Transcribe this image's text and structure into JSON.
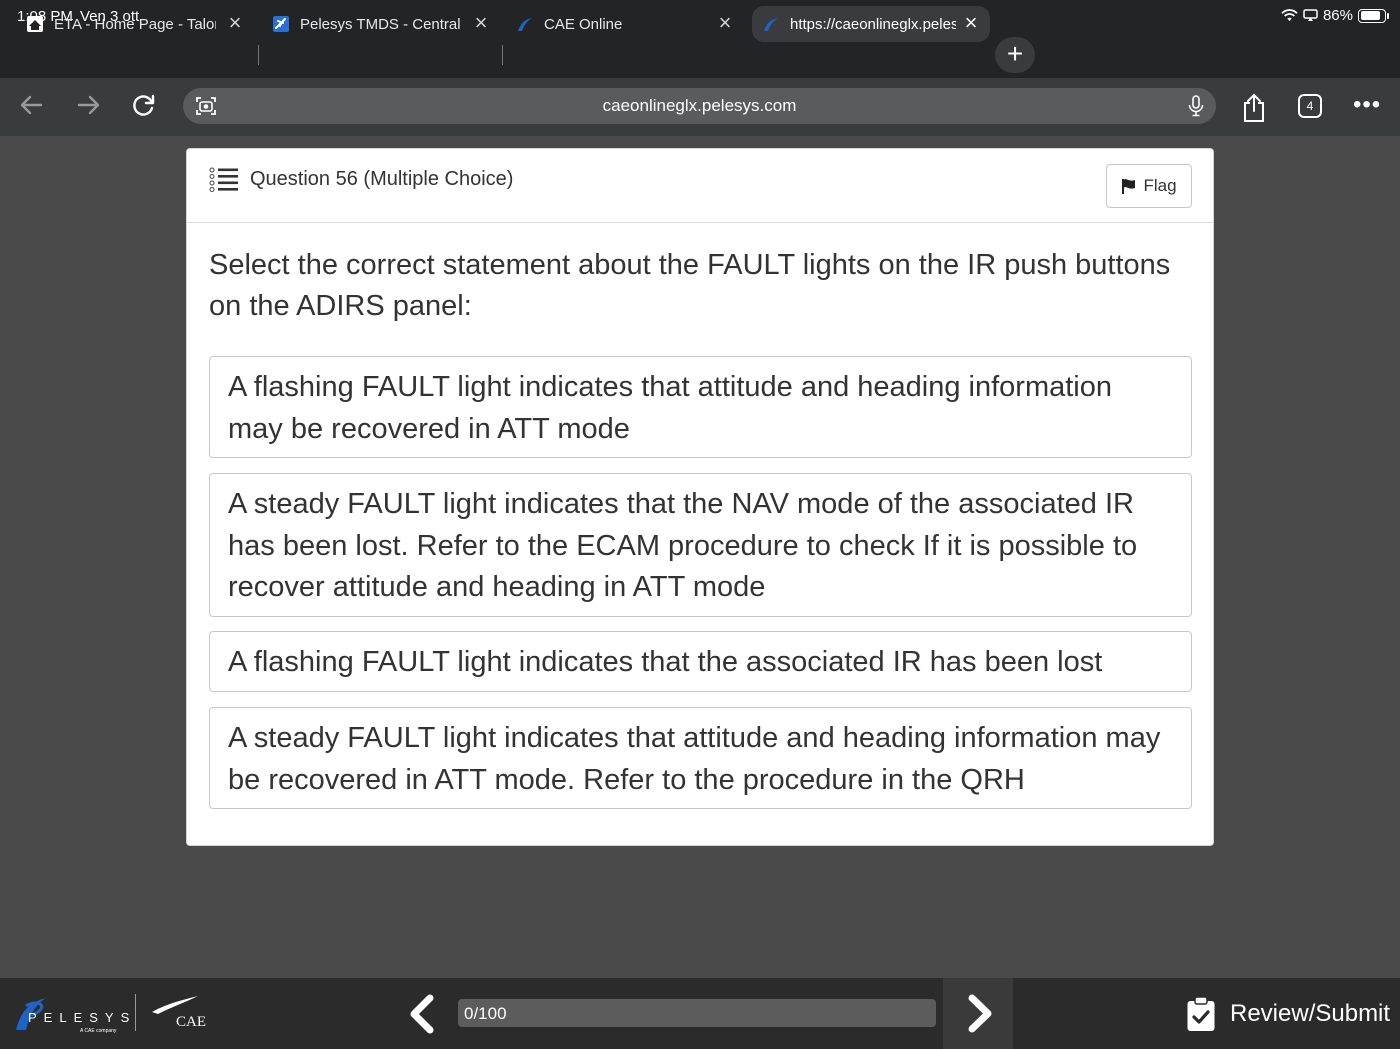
{
  "status": {
    "time": "1:08 PM",
    "date": "Ven 3 ott",
    "battery": "86%",
    "battery_level": 0.86
  },
  "tabs": [
    {
      "label": "ETA - Home Page - Talon",
      "icon": "home-icon",
      "active": false
    },
    {
      "label": "Pelesys TMDS - Central",
      "icon": "plane-icon",
      "active": false
    },
    {
      "label": "CAE Online",
      "icon": "pelesys-icon",
      "active": false
    },
    {
      "label": "https://caeonlineglx.pelesys",
      "icon": "pelesys-icon",
      "active": true
    }
  ],
  "toolbar": {
    "url": "caeonlineglx.pelesys.com",
    "tab_count": "4"
  },
  "question": {
    "title": "Question 56 (Multiple Choice)",
    "flag_label": "Flag",
    "prompt": "Select the correct statement about the FAULT lights on the IR push buttons on the ADIRS panel:",
    "options": [
      "A flashing FAULT light indicates that attitude and heading information may be recovered in ATT mode",
      "A steady FAULT light indicates that the NAV mode of the associated IR has been lost. Refer to the ECAM procedure to check If it is possible to recover attitude and heading in ATT mode",
      "A flashing FAULT light indicates that the associated IR has been lost",
      "A steady FAULT light indicates that attitude and heading information may be recovered in ATT mode. Refer to the procedure in the QRH"
    ]
  },
  "footer": {
    "brand": "PELESYS",
    "brand_sub": "A CAE company",
    "partner": "CAE",
    "progress_text": "0/100",
    "progress_value": 0,
    "review_label": "Review/Submit"
  },
  "colors": {
    "accent": "#1e63c6",
    "page_bg": "#4a4a4a",
    "chrome_bg": "#232426"
  }
}
